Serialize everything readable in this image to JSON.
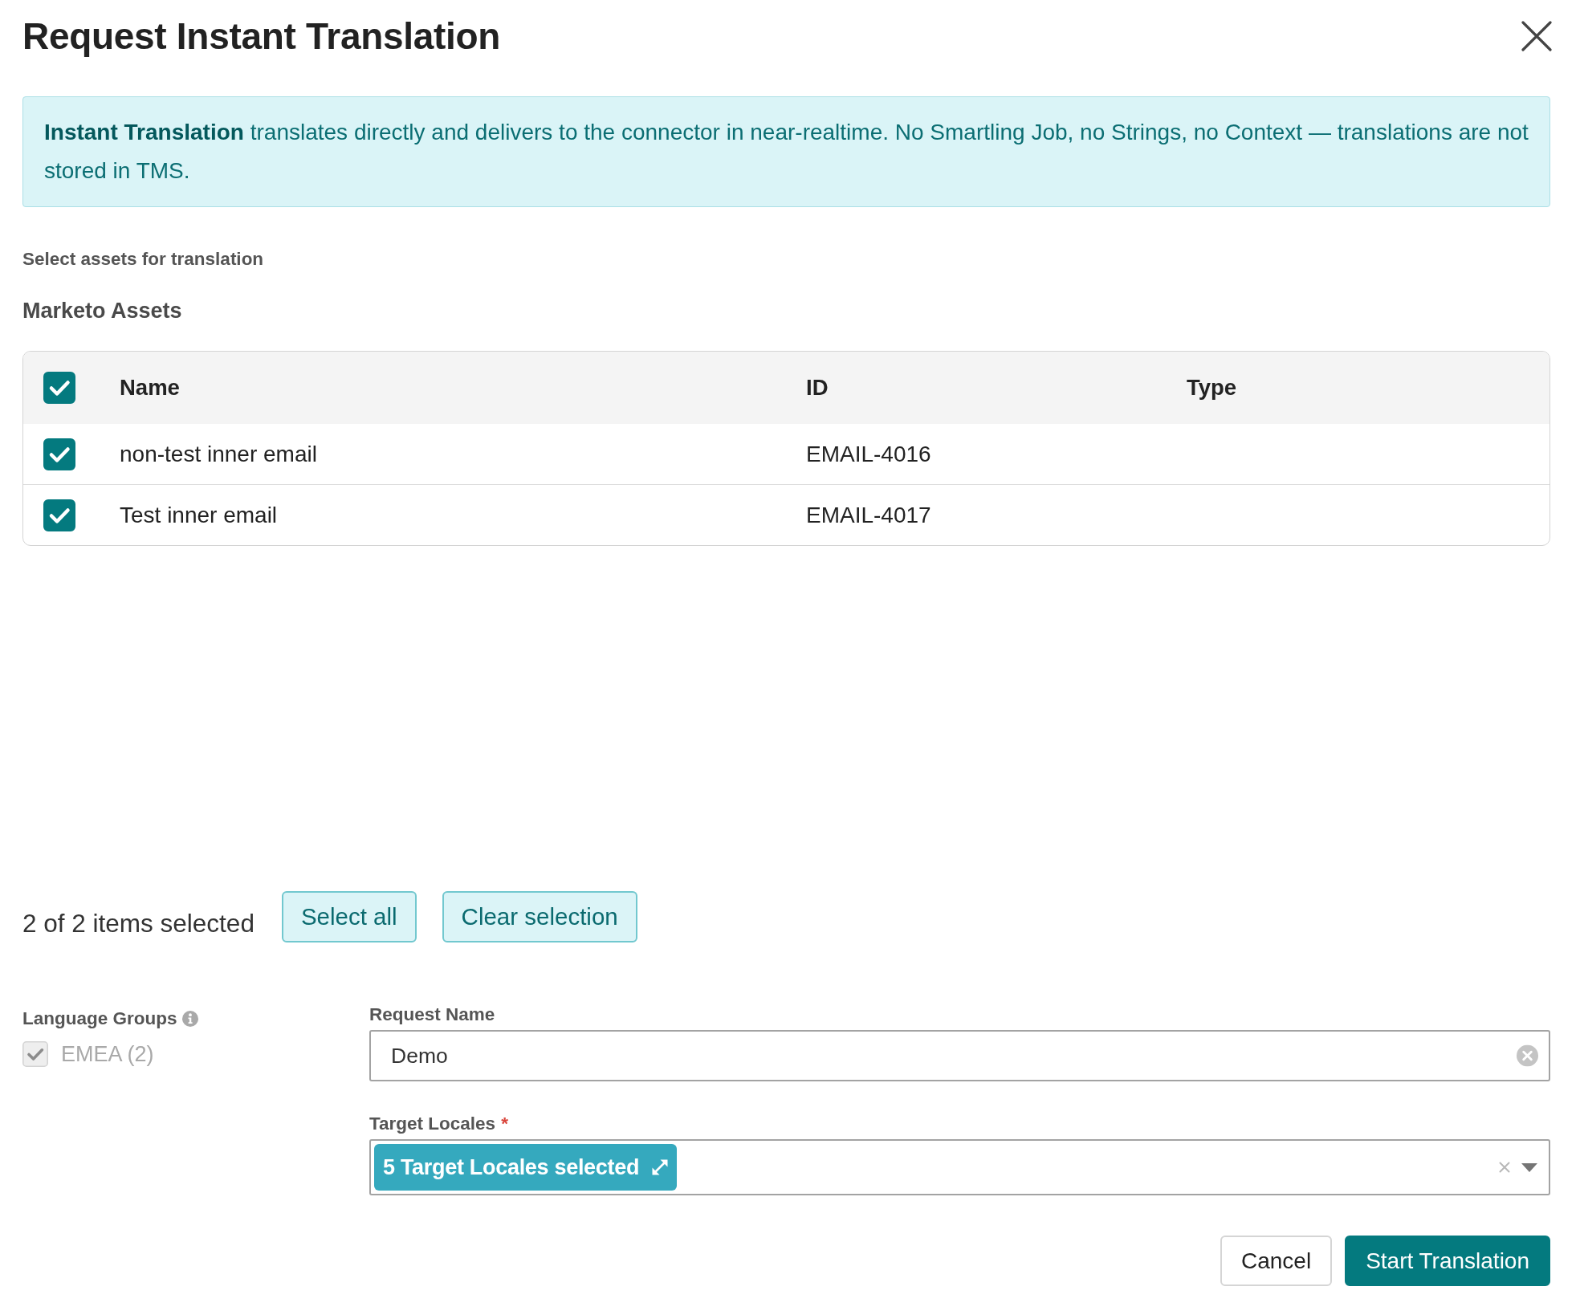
{
  "dialog": {
    "title": "Request Instant Translation"
  },
  "notice": {
    "text": "**Instant Translation** translates directly and delivers to the connector in near-realtime. No Smartling Job, no Strings, no Context — translations are not stored in TMS."
  },
  "assets": {
    "prompt": "Select assets for translation",
    "heading": "Marketo Assets",
    "all_checked": true,
    "columns": [
      "Name",
      "ID",
      "Type"
    ],
    "rows": [
      {
        "checked": true,
        "name": "non-test inner email",
        "id": "EMAIL-4016"
      },
      {
        "checked": true,
        "name": "Test inner email",
        "id": "EMAIL-4017"
      }
    ]
  },
  "selection": {
    "summary": "2 of 2 items selected",
    "buttons": [
      "Select all",
      "Clear selection"
    ]
  },
  "language_groups": {
    "label": "Language Groups",
    "items": [
      {
        "label": "EMEA (2)",
        "checked": true,
        "disabled": true
      }
    ]
  },
  "request_name": {
    "label": "Request Name",
    "value": "Demo"
  },
  "target_locales": {
    "label": "Target Locales",
    "required_mark": "*",
    "chip": "5 Target Locales selected"
  },
  "footer": {
    "buttons": [
      {
        "label": "Cancel",
        "kind": "secondary"
      },
      {
        "label": "Start Translation",
        "kind": "primary"
      }
    ]
  }
}
